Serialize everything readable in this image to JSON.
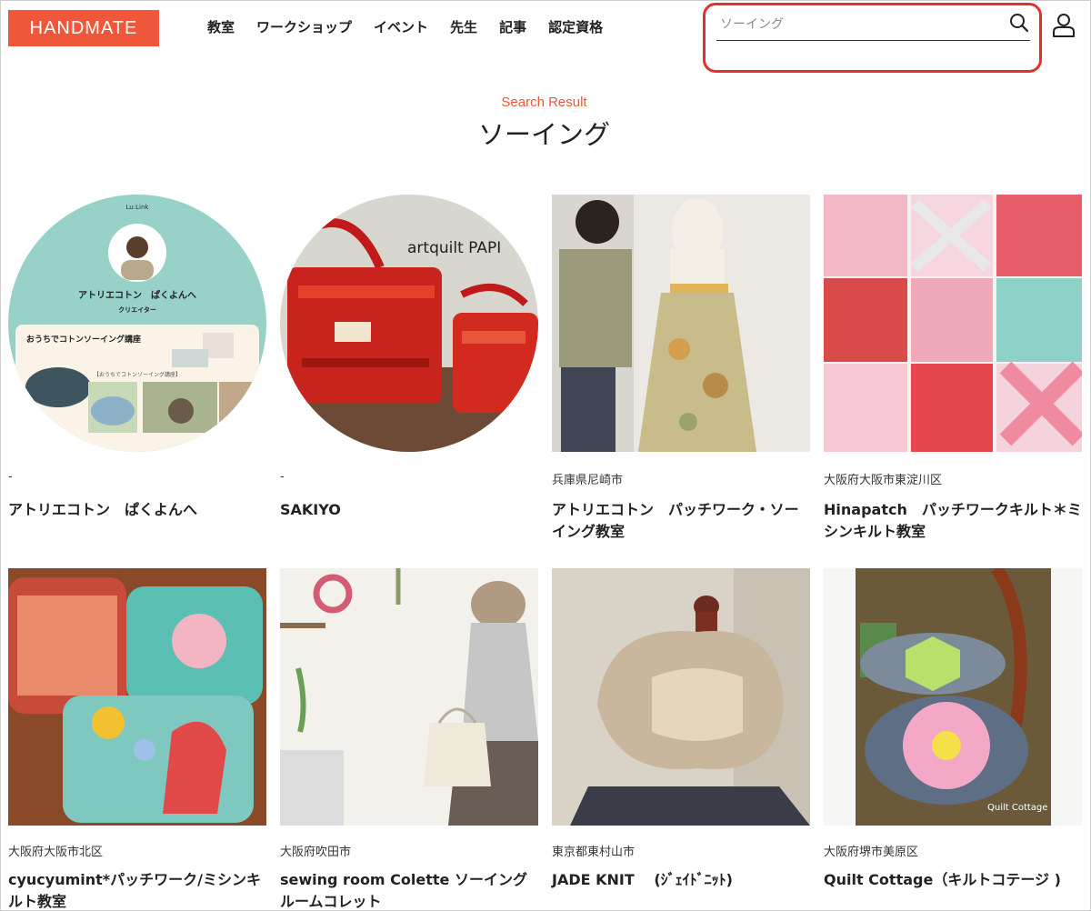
{
  "header": {
    "logo": "HANDMATE",
    "nav": [
      "教室",
      "ワークショップ",
      "イベント",
      "先生",
      "記事",
      "認定資格"
    ]
  },
  "search": {
    "value": "",
    "placeholder": "ソーイング",
    "icon": "search-icon"
  },
  "user": {
    "icon": "user-icon"
  },
  "results": {
    "eyebrow": "Search Result",
    "title": "ソーイング",
    "cards": [
      {
        "location": "-",
        "name": "アトリエコトン　ぱくよんへ",
        "image_text": {
          "brand": "Lu:Link",
          "person": "アトリエコトン　ぱくよんへ",
          "role": "クリエイター",
          "course": "おうちでコトンソーイング講座",
          "subtitle": "【おうちでコトンソーイング講座】"
        }
      },
      {
        "location": "-",
        "name": "SAKIYO",
        "image_text": {
          "sign": "artquilt PAPI"
        }
      },
      {
        "location": "兵庫県尼崎市",
        "name": "アトリエコトン　パッチワーク・ソーイング教室"
      },
      {
        "location": "大阪府大阪市東淀川区",
        "name": "Hinapatch　パッチワークキルト＊ミシンキルト教室"
      },
      {
        "location": "大阪府大阪市北区",
        "name": "cyucyumint*パッチワーク/ミシンキルト教室"
      },
      {
        "location": "大阪府吹田市",
        "name": "sewing room Colette ソーイングルームコレット"
      },
      {
        "location": "東京都東村山市",
        "name": "JADE KNIT　 (ｼﾞｪｲﾄﾞﾆｯﾄ)"
      },
      {
        "location": "大阪府堺市美原区",
        "name": "Quilt Cottage（キルトコテージ )",
        "image_text": {
          "watermark": "Quilt Cottage"
        }
      }
    ]
  },
  "colors": {
    "brand": "#f0573a",
    "highlight": "#e5302a"
  }
}
